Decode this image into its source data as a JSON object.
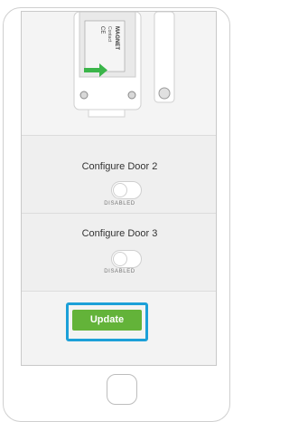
{
  "photo": {
    "label_line1": "MAGNET",
    "label_line2": "Contact",
    "label_code": "CE"
  },
  "door2": {
    "title": "Configure Door 2",
    "state": "DISABLED"
  },
  "door3": {
    "title": "Configure Door 3",
    "state": "DISABLED"
  },
  "actions": {
    "update_label": "Update"
  },
  "colors": {
    "accent_green": "#63b339",
    "focus_blue": "#1ca0d8"
  }
}
